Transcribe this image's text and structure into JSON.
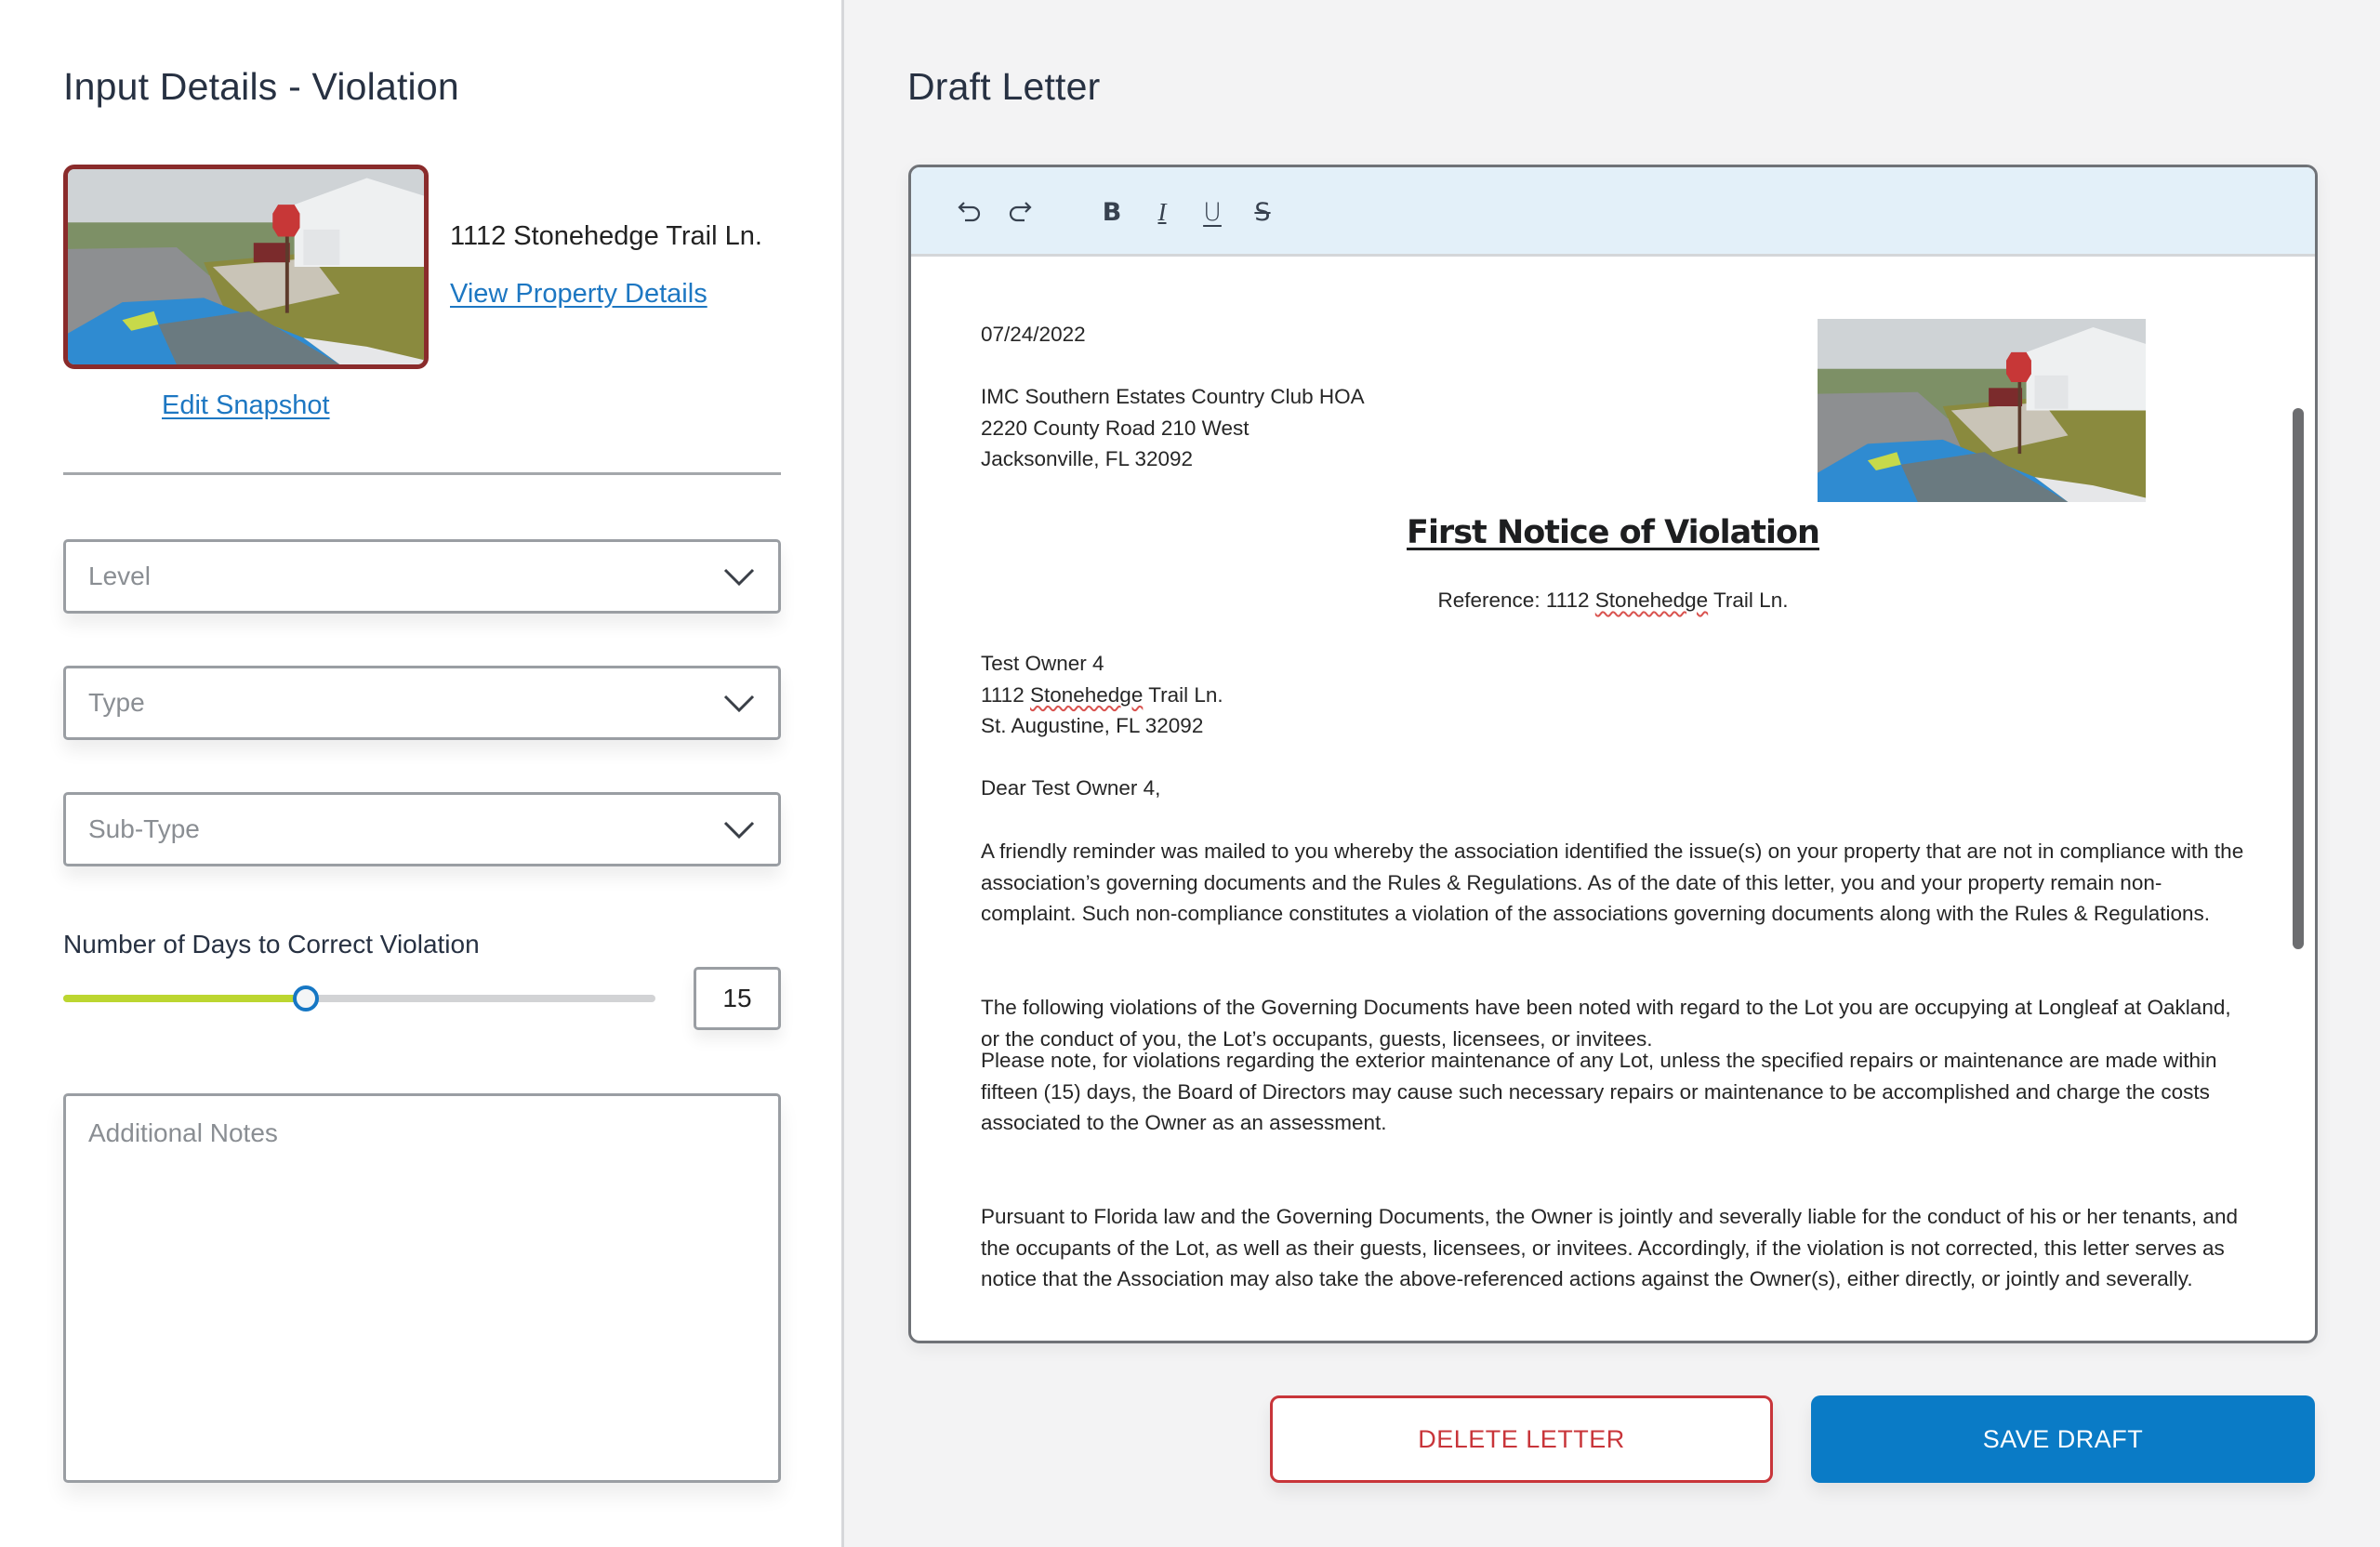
{
  "left_panel": {
    "title": "Input Details - Violation",
    "snapshot_alt": "Street-view snapshot of property with stop sign",
    "address": "1112 Stonehedge Trail Ln.",
    "view_property_link": "View Property Details",
    "edit_snapshot_link": "Edit Snapshot",
    "selects": [
      {
        "placeholder": "Level",
        "value": ""
      },
      {
        "placeholder": "Type",
        "value": ""
      },
      {
        "placeholder": "Sub-Type",
        "value": ""
      }
    ],
    "days_slider": {
      "label": "Number of Days to Correct Violation",
      "value": "15",
      "fill_fraction": 0.41
    },
    "notes": {
      "placeholder": "Additional Notes",
      "value": ""
    }
  },
  "right_panel": {
    "title": "Draft Letter",
    "toolbar": {
      "undo": "undo-icon",
      "redo": "redo-icon",
      "bold": "B",
      "italic": "I",
      "underline": "U",
      "strike": "S"
    },
    "letter": {
      "date": "07/24/2022",
      "assoc_name": "IMC Southern Estates Country Club HOA",
      "assoc_street": "2220 County Road 210 West",
      "assoc_city": "Jacksonville, FL 32092",
      "title": "First Notice of Violation",
      "reference_prefix": "Reference: 1112 ",
      "reference_word": "Stonehedge",
      "reference_suffix": " Trail Ln.",
      "owner_name": "Test Owner 4",
      "owner_street_prefix": "1112 ",
      "owner_street_word": "Stonehedge",
      "owner_street_suffix": " Trail Ln.",
      "owner_city": "St. Augustine, FL 32092",
      "salutation": "Dear Test Owner 4,",
      "paragraphs": [
        "A friendly reminder was mailed to you whereby the association identified the issue(s) on your property that are not in compliance with the association’s governing documents and the Rules & Regulations. As of the date of this letter, you and your property remain non-complaint. Such non-compliance constitutes a violation of the associations governing documents along with the Rules & Regulations.",
        "The following violations of the Governing Documents have been noted with regard to the Lot you are occupying at Longleaf at Oakland, or the conduct of you, the Lot’s occupants, guests, licensees, or invitees.",
        "Please note, for violations regarding the exterior maintenance of any Lot, unless the specified repairs or maintenance are made within fifteen (15) days, the Board of Directors may cause such necessary repairs or maintenance to be accomplished and charge the costs associated to the Owner as an assessment.",
        "Pursuant to Florida law and the Governing Documents, the Owner is jointly and severally liable for the conduct of his or her tenants, and the occupants of the Lot, as well as their guests, licensees, or invitees. Accordingly, if the violation is not corrected, this letter serves as notice that the Association may also take the above-referenced actions against the Owner(s), either directly, or jointly and severally."
      ]
    },
    "buttons": {
      "delete": "DELETE LETTER",
      "save": "SAVE DRAFT"
    }
  },
  "colors": {
    "accent_blue": "#0a7bc6",
    "link_blue": "#1d77c2",
    "danger_red": "#c8353a",
    "slider_fill": "#bcd630",
    "toolbar_bg": "#e3f0f9",
    "snapshot_border": "#8a2b2b"
  }
}
